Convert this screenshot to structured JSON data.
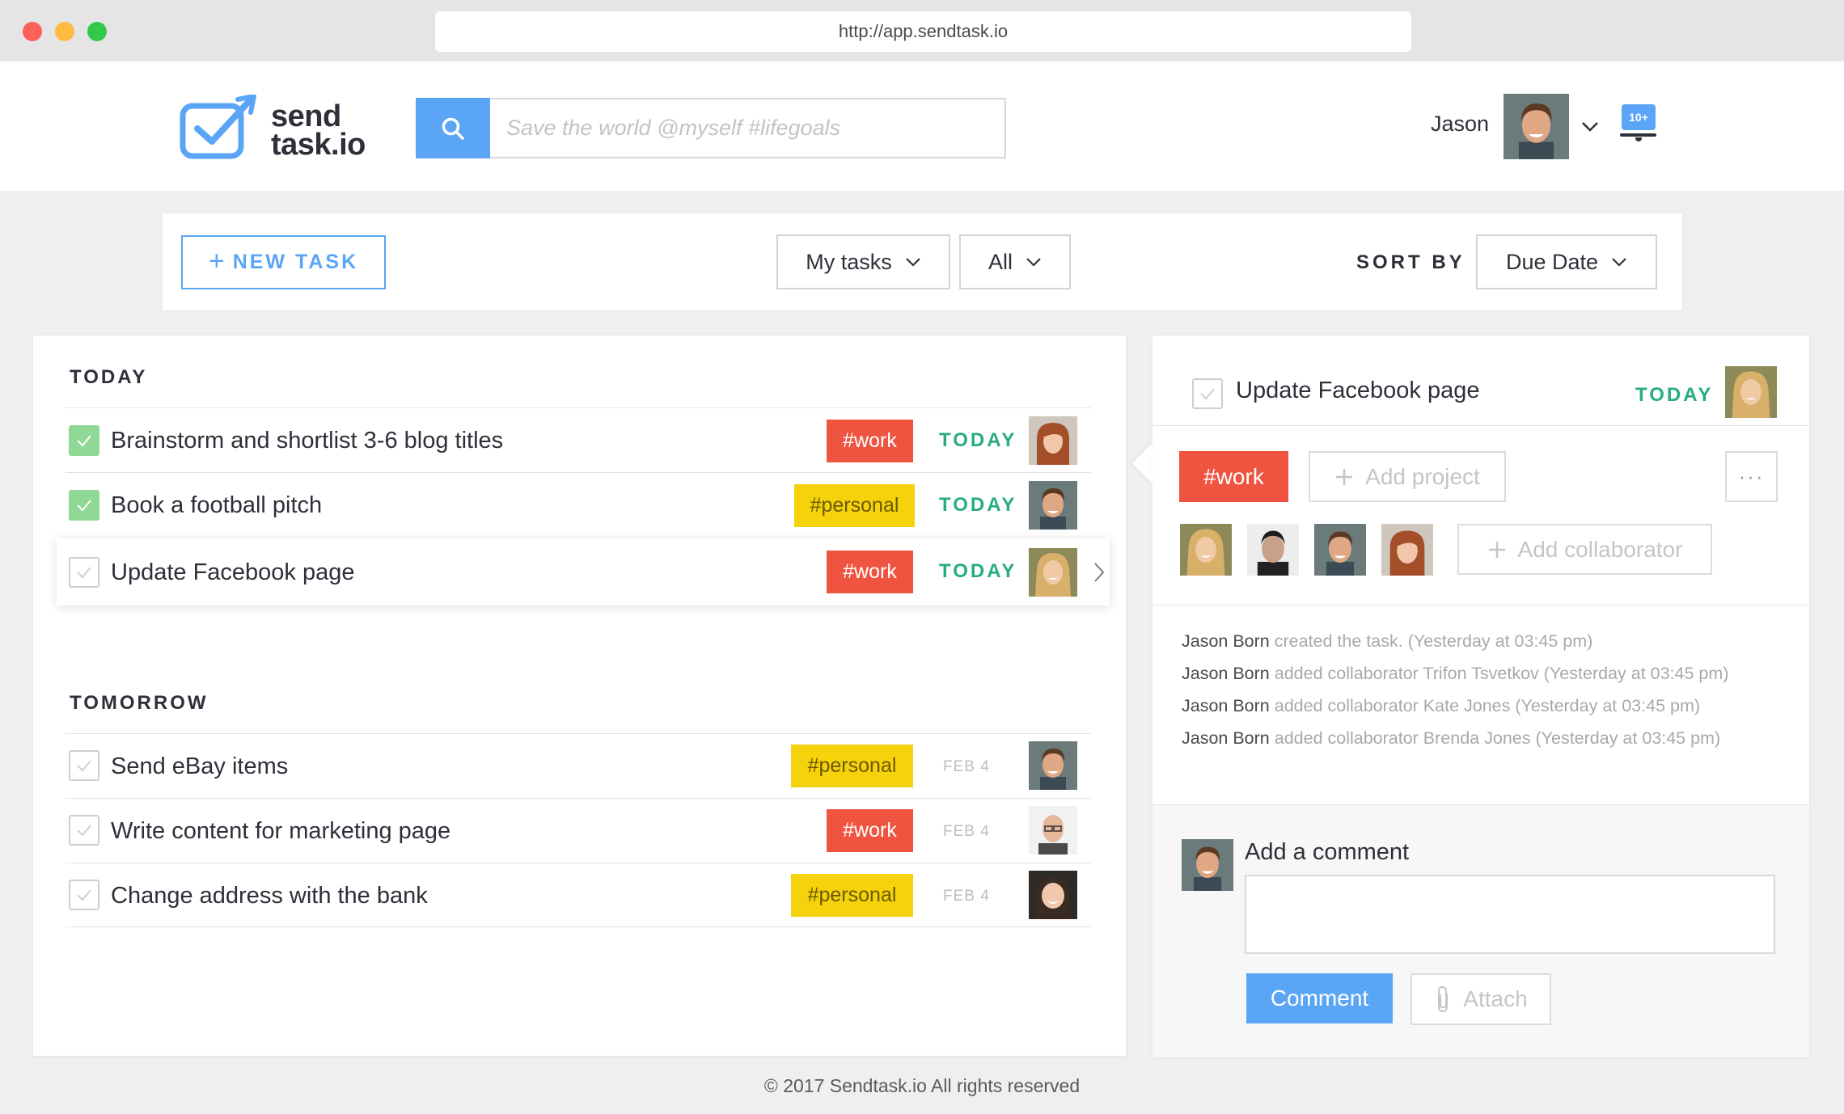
{
  "browser": {
    "url": "http://app.sendtask.io"
  },
  "header": {
    "logo_line1": "send",
    "logo_line2": "task.io",
    "search_placeholder": "Save the world @myself #lifegoals",
    "user_name": "Jason",
    "notification_badge": "10+"
  },
  "toolbar": {
    "new_task_label": "NEW TASK",
    "filter_owner": "My tasks",
    "filter_scope": "All",
    "sort_label": "SORT BY",
    "sort_value": "Due Date"
  },
  "sections": {
    "today": {
      "title": "TODAY",
      "tasks": [
        {
          "title": "Brainstorm and shortlist 3-6 blog titles",
          "tag": "#work",
          "due": "TODAY",
          "done": true
        },
        {
          "title": "Book a football pitch",
          "tag": "#personal",
          "due": "TODAY",
          "done": true
        },
        {
          "title": "Update Facebook page",
          "tag": "#work",
          "due": "TODAY",
          "done": false,
          "selected": true
        }
      ]
    },
    "tomorrow": {
      "title": "TOMORROW",
      "tasks": [
        {
          "title": "Send eBay items",
          "tag": "#personal",
          "due": "FEB 4",
          "done": false
        },
        {
          "title": "Write content for marketing page",
          "tag": "#work",
          "due": "FEB 4",
          "done": false
        },
        {
          "title": "Change address with the bank",
          "tag": "#personal",
          "due": "FEB 4",
          "done": false
        }
      ]
    }
  },
  "detail": {
    "title": "Update Facebook page",
    "due": "TODAY",
    "tag": "#work",
    "add_project_label": "Add project",
    "more_label": "···",
    "add_collaborator_label": "Add collaborator",
    "activity": [
      {
        "actor": "Jason Born",
        "text": " created the task. (Yesterday at 03:45 pm)"
      },
      {
        "actor": "Jason Born",
        "text": " added collaborator Trifon Tsvetkov (Yesterday at 03:45 pm)"
      },
      {
        "actor": "Jason Born",
        "text": " added collaborator Kate Jones (Yesterday at 03:45 pm)"
      },
      {
        "actor": "Jason Born",
        "text": " added collaborator Brenda Jones (Yesterday at 03:45 pm)"
      }
    ],
    "comment": {
      "label": "Add a comment",
      "value": "",
      "submit_label": "Comment",
      "attach_label": "Attach"
    }
  },
  "footer": "© 2017 Sendtask.io All rights reserved",
  "colors": {
    "accent": "#5aa5f6",
    "work_tag": "#ef5440",
    "personal_tag": "#f5d20b",
    "due_today": "#27ae7a",
    "done_check": "#8fd896"
  }
}
